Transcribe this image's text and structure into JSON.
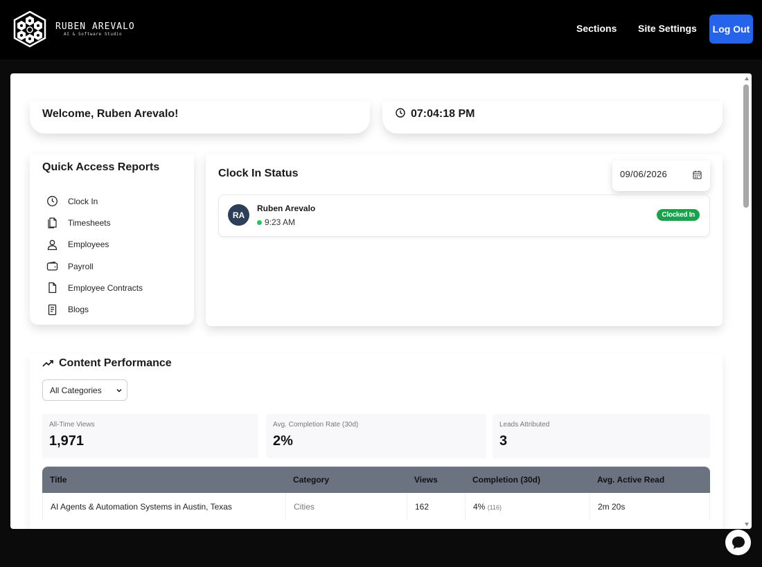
{
  "brand": {
    "name": "RUBEN AREVALO",
    "tagline": "AI & Software Studio"
  },
  "nav": {
    "sections": "Sections",
    "site_settings": "Site Settings",
    "logout": "Log Out"
  },
  "welcome": {
    "text": "Welcome, Ruben Arevalo!"
  },
  "clock": {
    "time": "07:04:18 PM"
  },
  "quick_access": {
    "title": "Quick Access Reports",
    "items": [
      {
        "label": "Clock In",
        "icon": "clock-icon"
      },
      {
        "label": "Timesheets",
        "icon": "timesheets-icon"
      },
      {
        "label": "Employees",
        "icon": "user-icon"
      },
      {
        "label": "Payroll",
        "icon": "wallet-icon"
      },
      {
        "label": "Employee Contracts",
        "icon": "document-icon"
      },
      {
        "label": "Blogs",
        "icon": "blog-icon"
      }
    ]
  },
  "clock_in_status": {
    "title": "Clock In Status",
    "date": "09/06/2026",
    "employee": {
      "initials": "RA",
      "name": "Ruben Arevalo",
      "time": "9:23 AM",
      "status": "Clocked In"
    }
  },
  "content_performance": {
    "title": "Content Performance",
    "category_filter": "All Categories",
    "stats": [
      {
        "label": "All-Time Views",
        "value": "1,971"
      },
      {
        "label": "Avg. Completion Rate (30d)",
        "value": "2%"
      },
      {
        "label": "Leads Attributed",
        "value": "3"
      }
    ],
    "table": {
      "headers": [
        "Title",
        "Category",
        "Views",
        "Completion (30d)",
        "Avg. Active Read"
      ],
      "rows": [
        {
          "title": "AI Agents & Automation Systems in Austin, Texas",
          "category": "Cities",
          "views": "162",
          "completion": "4%",
          "completion_count": "(116)",
          "avg_read": "2m 20s"
        }
      ]
    }
  },
  "colors": {
    "accent": "#2563eb",
    "status_green": "#16a34a",
    "table_header": "#6b7280",
    "avatar": "#2c3e58"
  }
}
